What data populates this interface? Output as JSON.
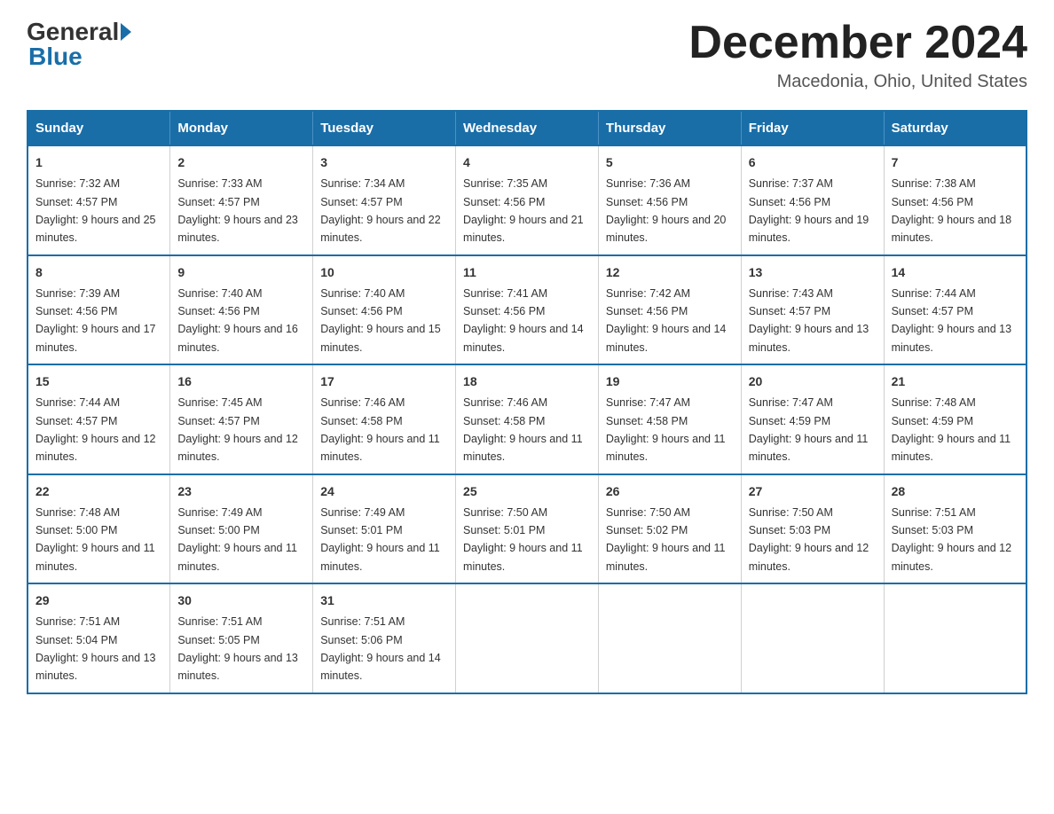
{
  "logo": {
    "general": "General",
    "blue": "Blue"
  },
  "header": {
    "month_year": "December 2024",
    "location": "Macedonia, Ohio, United States"
  },
  "weekdays": [
    "Sunday",
    "Monday",
    "Tuesday",
    "Wednesday",
    "Thursday",
    "Friday",
    "Saturday"
  ],
  "weeks": [
    [
      {
        "day": "1",
        "sunrise": "7:32 AM",
        "sunset": "4:57 PM",
        "daylight": "9 hours and 25 minutes."
      },
      {
        "day": "2",
        "sunrise": "7:33 AM",
        "sunset": "4:57 PM",
        "daylight": "9 hours and 23 minutes."
      },
      {
        "day": "3",
        "sunrise": "7:34 AM",
        "sunset": "4:57 PM",
        "daylight": "9 hours and 22 minutes."
      },
      {
        "day": "4",
        "sunrise": "7:35 AM",
        "sunset": "4:56 PM",
        "daylight": "9 hours and 21 minutes."
      },
      {
        "day": "5",
        "sunrise": "7:36 AM",
        "sunset": "4:56 PM",
        "daylight": "9 hours and 20 minutes."
      },
      {
        "day": "6",
        "sunrise": "7:37 AM",
        "sunset": "4:56 PM",
        "daylight": "9 hours and 19 minutes."
      },
      {
        "day": "7",
        "sunrise": "7:38 AM",
        "sunset": "4:56 PM",
        "daylight": "9 hours and 18 minutes."
      }
    ],
    [
      {
        "day": "8",
        "sunrise": "7:39 AM",
        "sunset": "4:56 PM",
        "daylight": "9 hours and 17 minutes."
      },
      {
        "day": "9",
        "sunrise": "7:40 AM",
        "sunset": "4:56 PM",
        "daylight": "9 hours and 16 minutes."
      },
      {
        "day": "10",
        "sunrise": "7:40 AM",
        "sunset": "4:56 PM",
        "daylight": "9 hours and 15 minutes."
      },
      {
        "day": "11",
        "sunrise": "7:41 AM",
        "sunset": "4:56 PM",
        "daylight": "9 hours and 14 minutes."
      },
      {
        "day": "12",
        "sunrise": "7:42 AM",
        "sunset": "4:56 PM",
        "daylight": "9 hours and 14 minutes."
      },
      {
        "day": "13",
        "sunrise": "7:43 AM",
        "sunset": "4:57 PM",
        "daylight": "9 hours and 13 minutes."
      },
      {
        "day": "14",
        "sunrise": "7:44 AM",
        "sunset": "4:57 PM",
        "daylight": "9 hours and 13 minutes."
      }
    ],
    [
      {
        "day": "15",
        "sunrise": "7:44 AM",
        "sunset": "4:57 PM",
        "daylight": "9 hours and 12 minutes."
      },
      {
        "day": "16",
        "sunrise": "7:45 AM",
        "sunset": "4:57 PM",
        "daylight": "9 hours and 12 minutes."
      },
      {
        "day": "17",
        "sunrise": "7:46 AM",
        "sunset": "4:58 PM",
        "daylight": "9 hours and 11 minutes."
      },
      {
        "day": "18",
        "sunrise": "7:46 AM",
        "sunset": "4:58 PM",
        "daylight": "9 hours and 11 minutes."
      },
      {
        "day": "19",
        "sunrise": "7:47 AM",
        "sunset": "4:58 PM",
        "daylight": "9 hours and 11 minutes."
      },
      {
        "day": "20",
        "sunrise": "7:47 AM",
        "sunset": "4:59 PM",
        "daylight": "9 hours and 11 minutes."
      },
      {
        "day": "21",
        "sunrise": "7:48 AM",
        "sunset": "4:59 PM",
        "daylight": "9 hours and 11 minutes."
      }
    ],
    [
      {
        "day": "22",
        "sunrise": "7:48 AM",
        "sunset": "5:00 PM",
        "daylight": "9 hours and 11 minutes."
      },
      {
        "day": "23",
        "sunrise": "7:49 AM",
        "sunset": "5:00 PM",
        "daylight": "9 hours and 11 minutes."
      },
      {
        "day": "24",
        "sunrise": "7:49 AM",
        "sunset": "5:01 PM",
        "daylight": "9 hours and 11 minutes."
      },
      {
        "day": "25",
        "sunrise": "7:50 AM",
        "sunset": "5:01 PM",
        "daylight": "9 hours and 11 minutes."
      },
      {
        "day": "26",
        "sunrise": "7:50 AM",
        "sunset": "5:02 PM",
        "daylight": "9 hours and 11 minutes."
      },
      {
        "day": "27",
        "sunrise": "7:50 AM",
        "sunset": "5:03 PM",
        "daylight": "9 hours and 12 minutes."
      },
      {
        "day": "28",
        "sunrise": "7:51 AM",
        "sunset": "5:03 PM",
        "daylight": "9 hours and 12 minutes."
      }
    ],
    [
      {
        "day": "29",
        "sunrise": "7:51 AM",
        "sunset": "5:04 PM",
        "daylight": "9 hours and 13 minutes."
      },
      {
        "day": "30",
        "sunrise": "7:51 AM",
        "sunset": "5:05 PM",
        "daylight": "9 hours and 13 minutes."
      },
      {
        "day": "31",
        "sunrise": "7:51 AM",
        "sunset": "5:06 PM",
        "daylight": "9 hours and 14 minutes."
      },
      null,
      null,
      null,
      null
    ]
  ],
  "labels": {
    "sunrise": "Sunrise:",
    "sunset": "Sunset:",
    "daylight": "Daylight:"
  }
}
